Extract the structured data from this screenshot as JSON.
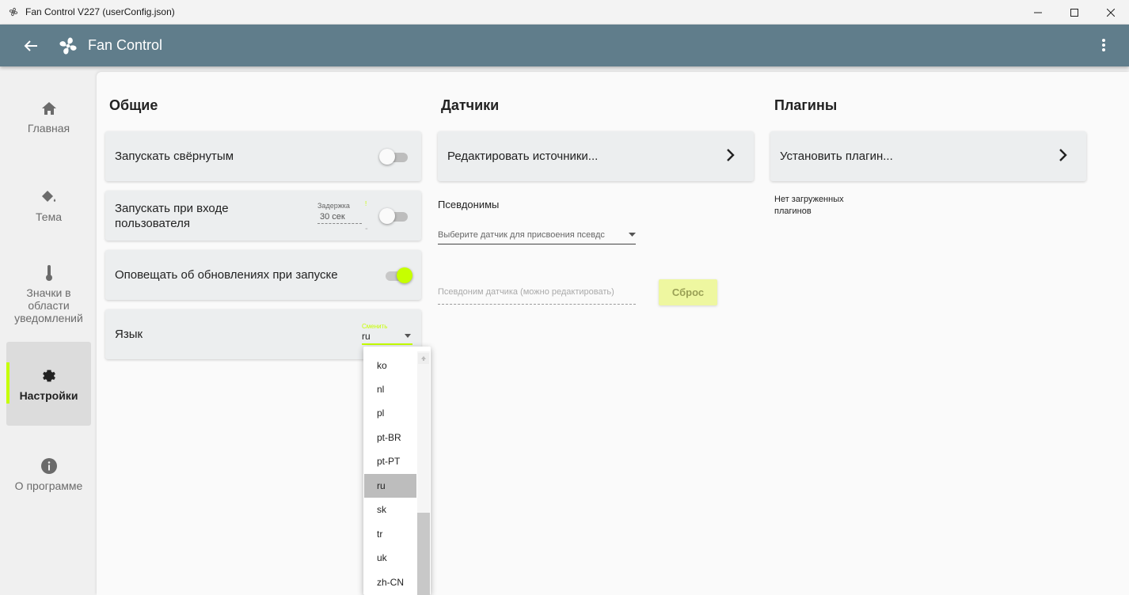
{
  "window": {
    "title": "Fan Control V227 (userConfig.json)",
    "controls": {
      "minimize": "—",
      "maximize": "☐",
      "close": "✕"
    }
  },
  "appbar": {
    "title": "Fan Control",
    "color": "#607d8b",
    "accent": "#c6ff00"
  },
  "sidebar": {
    "items": [
      {
        "label": "Главная",
        "icon": "home-icon",
        "active": false
      },
      {
        "label": "Тема",
        "icon": "paint-bucket-icon",
        "active": false
      },
      {
        "label": "Значки в области уведомлений",
        "icon": "thermometer-icon",
        "active": false
      },
      {
        "label": "Настройки",
        "icon": "gear-icon",
        "active": true
      },
      {
        "label": "О программе",
        "icon": "info-icon",
        "active": false
      }
    ]
  },
  "general": {
    "title": "Общие",
    "start_minimized": {
      "label": "Запускать свёрнутым",
      "on": false
    },
    "start_on_login": {
      "label": "Запускать при входе пользователя",
      "delay_caption": "Задержка",
      "delay_value": "30 сек",
      "delay_suffix": "-",
      "delay_mark": "!",
      "on": false
    },
    "notify_updates": {
      "label": "Оповещать об обновлениях при запуске",
      "on": true
    },
    "language": {
      "label": "Язык",
      "caption": "Сменить",
      "value": "ru",
      "options": [
        "ko",
        "nl",
        "pl",
        "pt-BR",
        "pt-PT",
        "ru",
        "sk",
        "tr",
        "uk",
        "zh-CN"
      ],
      "selected": "ru"
    }
  },
  "sensors": {
    "title": "Датчики",
    "edit_sources_label": "Редактировать источники...",
    "aliases_label": "Псевдонимы",
    "sensor_select_placeholder": "Выберите датчик для присвоения псевдс",
    "alias_input_placeholder": "Псевдоним датчика (можно редактировать)",
    "reset_label": "Сброс"
  },
  "plugins": {
    "title": "Плагины",
    "install_label": "Установить плагин...",
    "no_plugins_text_line1": "Нет загруженных",
    "no_plugins_text_line2": "плагинов"
  }
}
